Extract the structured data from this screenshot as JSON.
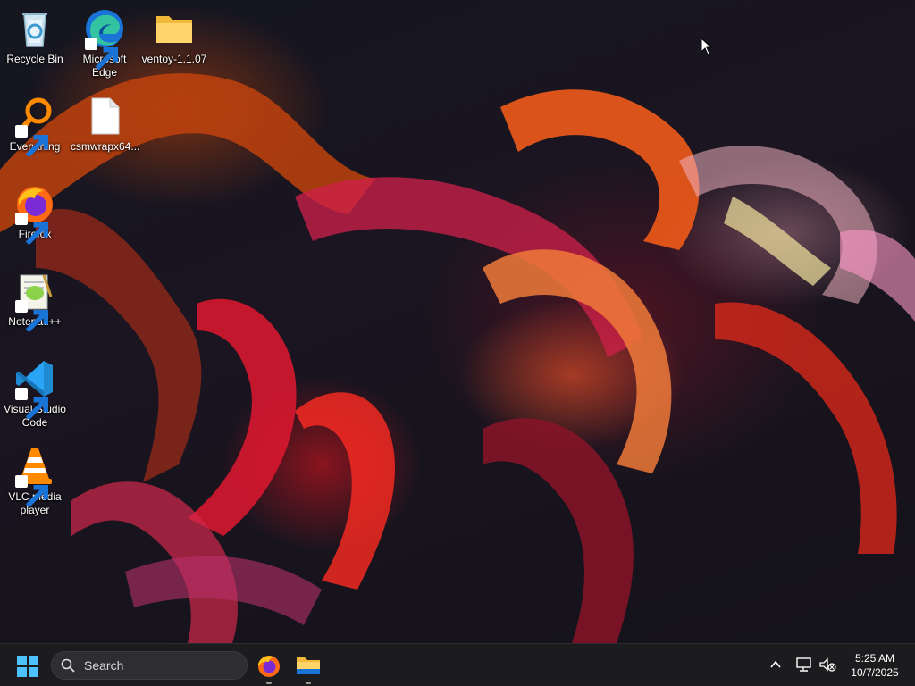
{
  "desktop": {
    "icons": [
      {
        "label": "Recycle Bin",
        "icon": "recycle-bin-icon"
      },
      {
        "label": "Microsoft Edge",
        "icon": "edge-icon"
      },
      {
        "label": "ventoy-1.1.07",
        "icon": "folder-icon"
      },
      {
        "label": "Everything",
        "icon": "everything-search-icon"
      },
      {
        "label": "csmwrapx64...",
        "icon": "file-icon"
      },
      {
        "label": "Firefox",
        "icon": "firefox-icon"
      },
      {
        "label": "Notepad++",
        "icon": "notepadpp-icon"
      },
      {
        "label": "Visual Studio Code",
        "icon": "vscode-icon"
      },
      {
        "label": "VLC media player",
        "icon": "vlc-icon"
      }
    ]
  },
  "taskbar": {
    "search_label": "Search",
    "pinned": [
      {
        "name": "Firefox",
        "icon": "firefox-icon"
      },
      {
        "name": "File Explorer",
        "icon": "file-explorer-icon"
      }
    ],
    "clock": {
      "time": "5:25 AM",
      "date": "10/7/2025"
    }
  },
  "colors": {
    "taskbar_bg": "#1c1c1f",
    "start_blue": "#4cc2ff",
    "accent_orange": "#e8621a"
  }
}
